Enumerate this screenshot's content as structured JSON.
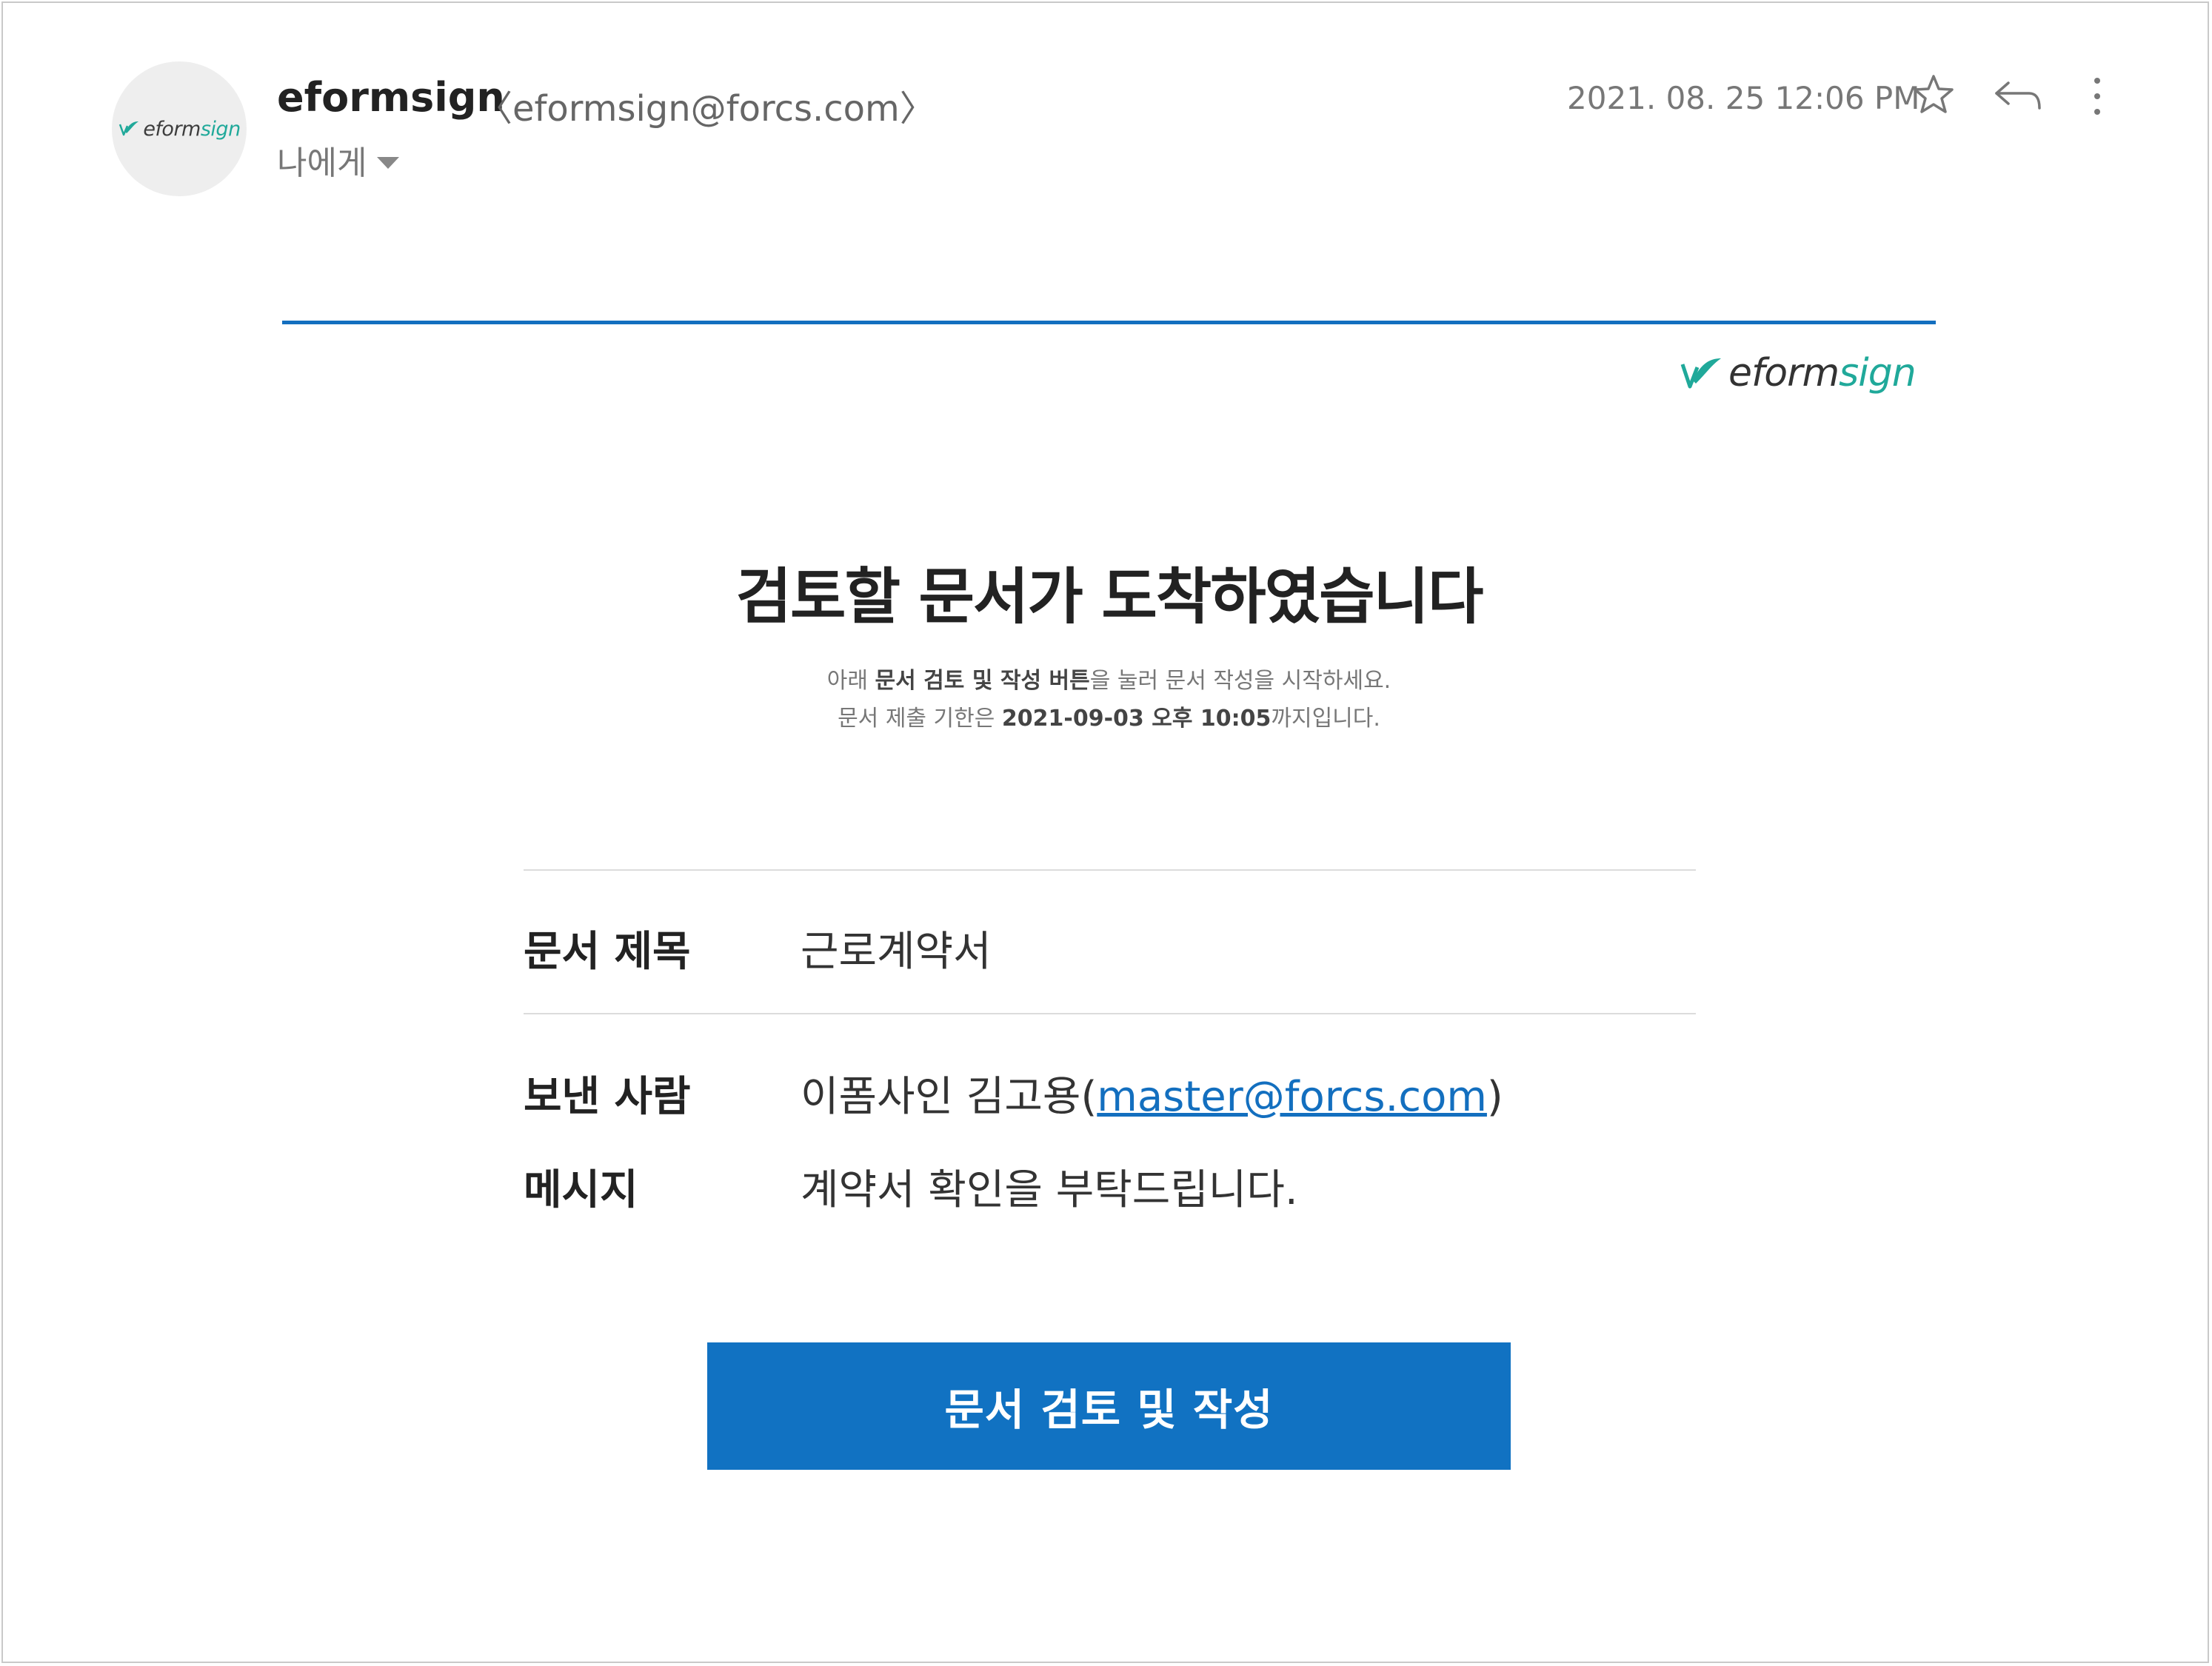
{
  "header": {
    "sender_name": "eformsign",
    "sender_address": "〈eformsign@forcs.com〉",
    "recipient_label": "나에게",
    "date": "2021. 08. 25 12:06 PM",
    "avatar_logo": {
      "word": "eform",
      "accent": "sign"
    }
  },
  "brand": {
    "logo_word": "eform",
    "logo_accent": "sign",
    "accent_color": "#136fbf",
    "logo_green": "#20a99a"
  },
  "body": {
    "headline": "검토할 문서가 도착하였습니다",
    "sub1": {
      "pre": "아래 ",
      "bold": "문서 검토 및 작성 버튼",
      "post": "을 눌러 문서 작성을 시작하세요."
    },
    "sub2": {
      "pre": "문서 제출 기한은 ",
      "bold": "2021-09-03 오후 10:05",
      "post": "까지입니다."
    },
    "fields": {
      "title_label": "문서 제목",
      "title_value": "근로계약서",
      "sender_label": "보낸 사람",
      "sender_value_pre": "이폼사인 김고용(",
      "sender_email": "master@forcs.com",
      "sender_value_post": ")",
      "message_label": "메시지",
      "message_value": "계약서 확인을 부탁드립니다."
    },
    "cta_label": "문서 검토 및 작성"
  },
  "icons": [
    "star-icon",
    "reply-icon",
    "more-vertical-icon",
    "eformsign-logo-icon"
  ]
}
